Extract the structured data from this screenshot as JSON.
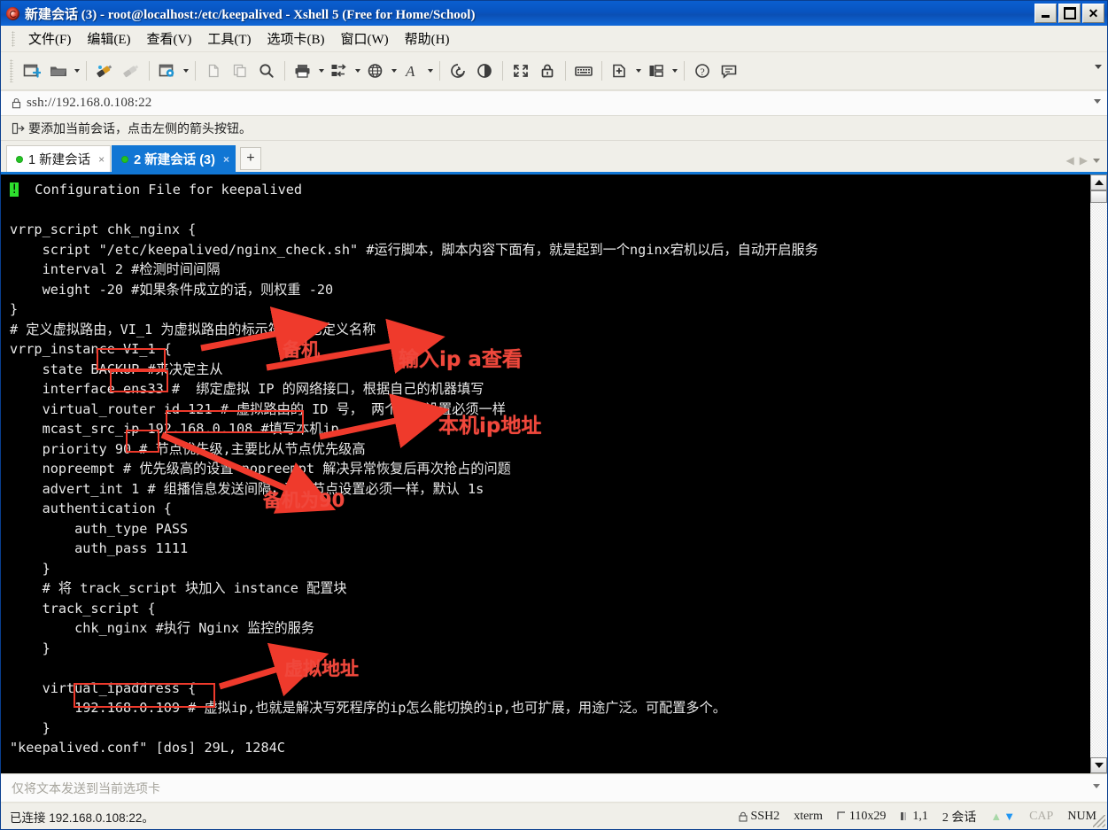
{
  "window": {
    "title": "新建会话 (3) - root@localhost:/etc/keepalived - Xshell 5 (Free for Home/School)",
    "minimize_label": "",
    "maximize_label": "",
    "close_label": "✕"
  },
  "menu": {
    "items": [
      {
        "label": "文件(F)",
        "name": "menu-file"
      },
      {
        "label": "编辑(E)",
        "name": "menu-edit"
      },
      {
        "label": "查看(V)",
        "name": "menu-view"
      },
      {
        "label": "工具(T)",
        "name": "menu-tools"
      },
      {
        "label": "选项卡(B)",
        "name": "menu-tabs"
      },
      {
        "label": "窗口(W)",
        "name": "menu-window"
      },
      {
        "label": "帮助(H)",
        "name": "menu-help"
      }
    ]
  },
  "toolbar": {
    "icons": [
      "new-session-icon",
      "open-folder-icon",
      "connect-icon",
      "disconnect-icon",
      "session-properties-icon",
      "copy-icon",
      "paste-icon",
      "find-icon",
      "print-icon",
      "transfer-icon",
      "browser-icon",
      "font-icon",
      "log-icon",
      "record-icon",
      "fullscreen-icon",
      "lock-icon",
      "keyboard-icon",
      "add-tab-icon",
      "layout-icon",
      "help-icon",
      "feedback-icon"
    ]
  },
  "address": {
    "value": "ssh://192.168.0.108:22",
    "lock_icon": "lock-icon"
  },
  "hint": {
    "text": "要添加当前会话，点击左侧的箭头按钮。",
    "icon": "add-session-arrow-icon"
  },
  "tabs": {
    "items": [
      {
        "label": "1 新建会话",
        "active": false,
        "close": "×"
      },
      {
        "label": "2 新建会话 (3)",
        "active": true,
        "close": "×"
      }
    ],
    "add_label": "+",
    "nav_prev": "◀",
    "nav_next": "▶"
  },
  "terminal": {
    "lines": [
      "  Configuration File for keepalived",
      "",
      "vrrp_script chk_nginx {",
      "    script \"/etc/keepalived/nginx_check.sh\" #运行脚本，脚本内容下面有，就是起到一个nginx宕机以后，自动开启服务",
      "    interval 2 #检测时间间隔",
      "    weight -20 #如果条件成立的话，则权重 -20",
      "}",
      "# 定义虚拟路由，VI_1 为虚拟路由的标示符，自己定义名称",
      "vrrp_instance VI_1 {",
      "    state BACKUP #来决定主从",
      "    interface ens33 #  绑定虚拟 IP 的网络接口，根据自己的机器填写",
      "    virtual_router id 121 # 虚拟路由的 ID 号， 两个节点设置必须一样",
      "    mcast_src_ip 192.168.0.108 #填写本机ip",
      "    priority 90 # 节点优先级,主要比从节点优先级高",
      "    nopreempt # 优先级高的设置 nopreempt 解决异常恢复后再次抢占的问题",
      "    advert_int 1 # 组播信息发送间隔，两个节点设置必须一样，默认 1s",
      "    authentication {",
      "        auth_type PASS",
      "        auth_pass 1111",
      "    }",
      "    # 将 track_script 块加入 instance 配置块",
      "    track_script {",
      "        chk_nginx #执行 Nginx 监控的服务",
      "    }",
      "",
      "    virtual_ipaddress {",
      "        192.168.0.109 # 虚拟ip,也就是解决写死程序的ip怎么能切换的ip,也可扩展，用途广泛。可配置多个。",
      "    }",
      "\"keepalived.conf\" [dos] 29L, 1284C"
    ],
    "cursor_char": "!",
    "fg_color": "#e8e8e8",
    "bg_color": "#000000",
    "cursor_color": "#2ee02e"
  },
  "annotations": {
    "color": "#ef3a2c",
    "labels": [
      {
        "text": "备机",
        "name": "annotation-backup"
      },
      {
        "text": "输入ip a查看",
        "name": "annotation-ip-a"
      },
      {
        "text": "本机ip地址",
        "name": "annotation-local-ip"
      },
      {
        "text": "备机为90",
        "name": "annotation-priority-90"
      },
      {
        "text": "虚拟地址",
        "name": "annotation-virtual-ip"
      }
    ],
    "boxes": [
      "BACKUP",
      "ens33",
      "192.168.0.108",
      "90",
      "192.168.0.109"
    ]
  },
  "send_bar": {
    "text": "仅将文本发送到当前选项卡"
  },
  "status": {
    "connection": "已连接 192.168.0.108:22。",
    "protocol": "SSH2",
    "terminal_type": "xterm",
    "size": "110x29",
    "cursor_pos": "1,1",
    "sessions": "2 会话",
    "cap": "CAP",
    "num": "NUM"
  }
}
